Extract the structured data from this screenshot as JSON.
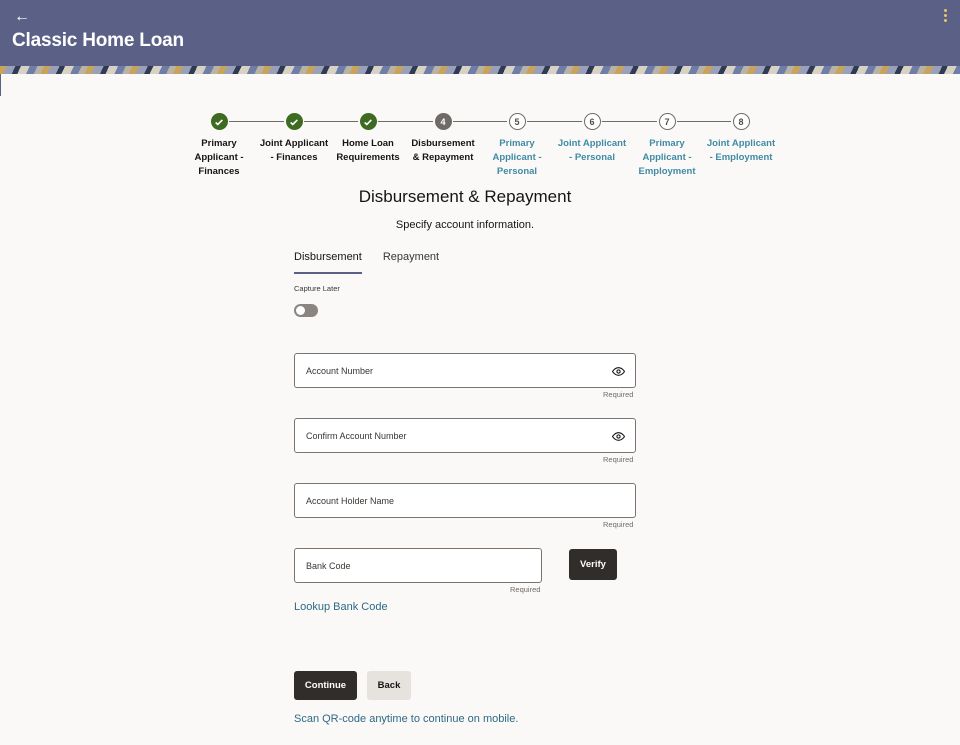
{
  "header": {
    "back_icon": "arrow-left-icon",
    "title": "Classic Home Loan",
    "menu_icon": "kebab-menu-icon",
    "accent": "#5b6086"
  },
  "stepper": {
    "steps": [
      {
        "marker": "",
        "state": "done",
        "label_lines": [
          "Primary",
          "Applicant -",
          "Finances"
        ]
      },
      {
        "marker": "",
        "state": "done",
        "label_lines": [
          "Joint Applicant",
          "- Finances"
        ]
      },
      {
        "marker": "",
        "state": "done",
        "label_lines": [
          "Home Loan",
          "Requirements"
        ]
      },
      {
        "marker": "4",
        "state": "current",
        "label_lines": [
          "Disbursement",
          "& Repayment"
        ]
      },
      {
        "marker": "5",
        "state": "future",
        "label_lines": [
          "Primary",
          "Applicant -",
          "Personal"
        ]
      },
      {
        "marker": "6",
        "state": "future",
        "label_lines": [
          "Joint Applicant",
          "- Personal"
        ]
      },
      {
        "marker": "7",
        "state": "future",
        "label_lines": [
          "Primary",
          "Applicant -",
          "Employment"
        ]
      },
      {
        "marker": "8",
        "state": "future",
        "label_lines": [
          "Joint Applicant",
          "- Employment"
        ]
      }
    ],
    "done_color": "#3d6b21",
    "link_color": "#3f8ba3"
  },
  "form": {
    "title": "Disbursement & Repayment",
    "subtitle": "Specify account information.",
    "tabs": [
      {
        "label": "Disbursement",
        "active": true
      },
      {
        "label": "Repayment",
        "active": false
      }
    ],
    "capture_later_label": "Capture Later",
    "capture_later_on": false,
    "fields": {
      "account_number": {
        "placeholder": "Account Number",
        "value": "",
        "helper": "Required"
      },
      "confirm_account_number": {
        "placeholder": "Confirm Account Number",
        "value": "",
        "helper": "Required"
      },
      "account_holder_name": {
        "placeholder": "Account Holder Name",
        "value": "",
        "helper": "Required"
      },
      "bank_code": {
        "placeholder": "Bank Code",
        "value": "",
        "helper": "Required"
      }
    },
    "verify_label": "Verify",
    "lookup_label": "Lookup Bank Code"
  },
  "actions": {
    "continue_label": "Continue",
    "back_label": "Back",
    "qr_text": "Scan QR-code anytime to continue on mobile."
  }
}
